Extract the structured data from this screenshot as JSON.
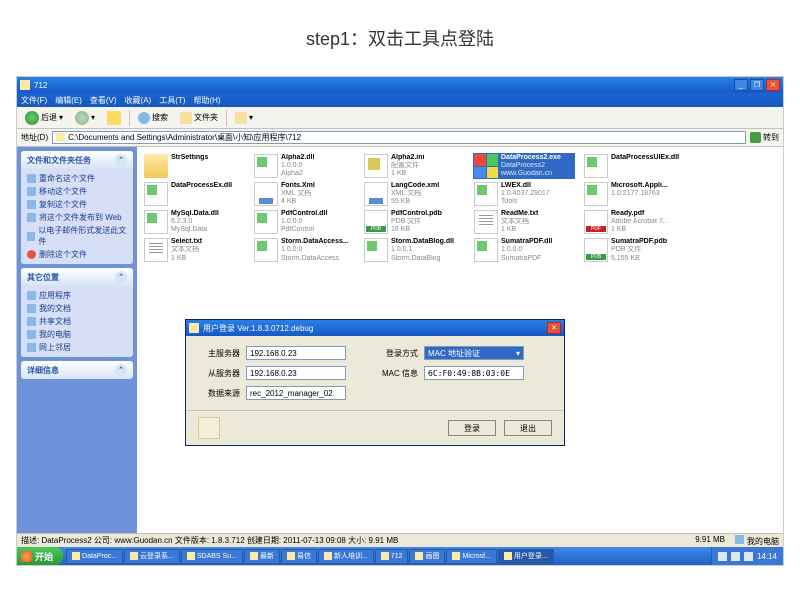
{
  "page_title": "step1：双击工具点登陆",
  "explorer": {
    "title": "712",
    "menu": [
      "文件(F)",
      "编辑(E)",
      "查看(V)",
      "收藏(A)",
      "工具(T)",
      "帮助(H)"
    ],
    "toolbar": {
      "back": "后退",
      "search": "搜索",
      "folders": "文件夹"
    },
    "address_label": "地址(D)",
    "address": "C:\\Documents and Settings\\Administrator\\桌面\\小知\\应用程序\\712",
    "go": "转到"
  },
  "sidebar": {
    "panels": [
      {
        "title": "文件和文件夹任务",
        "items": [
          {
            "icon": "rename",
            "label": "重命名这个文件"
          },
          {
            "icon": "move",
            "label": "移动这个文件"
          },
          {
            "icon": "copy",
            "label": "复制这个文件"
          },
          {
            "icon": "web",
            "label": "将这个文件发布到 Web"
          },
          {
            "icon": "mail",
            "label": "以电子邮件形式发送此文件"
          },
          {
            "icon": "del",
            "label": "删除这个文件"
          }
        ]
      },
      {
        "title": "其它位置",
        "items": [
          {
            "icon": "folder",
            "label": "应用程序"
          },
          {
            "icon": "docs",
            "label": "我的文档"
          },
          {
            "icon": "shared",
            "label": "共享文档"
          },
          {
            "icon": "pc",
            "label": "我的电脑"
          },
          {
            "icon": "net",
            "label": "网上邻居"
          }
        ]
      },
      {
        "title": "详细信息",
        "items": []
      }
    ]
  },
  "files": [
    {
      "icon": "folder",
      "name": "StrSettings",
      "meta1": "",
      "meta2": ""
    },
    {
      "icon": "dll",
      "name": "Alpha2.dll",
      "meta1": "1.0.0.0",
      "meta2": "Alpha2"
    },
    {
      "icon": "ini",
      "name": "Alpha2.ini",
      "meta1": "配置文件",
      "meta2": "1 KB"
    },
    {
      "icon": "exe",
      "name": "DataProcess2.exe",
      "meta1": "DataProcess2",
      "meta2": "www.Guodan.cn",
      "selected": true
    },
    {
      "icon": "dll",
      "name": "DataProcessUIEx.dll",
      "meta1": "",
      "meta2": ""
    },
    {
      "icon": "dll",
      "name": "DataProcessEx.dll",
      "meta1": "",
      "meta2": ""
    },
    {
      "icon": "xml",
      "name": "Fonts.Xml",
      "meta1": "XML 文档",
      "meta2": "4 KB"
    },
    {
      "icon": "xml",
      "name": "LangCode.xml",
      "meta1": "XML 文档",
      "meta2": "55 KB"
    },
    {
      "icon": "dll",
      "name": "LWEX.dll",
      "meta1": "1.0.4037.29017",
      "meta2": "Tools"
    },
    {
      "icon": "dll",
      "name": "Microsoft.Appli...",
      "meta1": "1.0.2177.18763",
      "meta2": ""
    },
    {
      "icon": "dll",
      "name": "MySql.Data.dll",
      "meta1": "6.2.3.0",
      "meta2": "MySql.Data"
    },
    {
      "icon": "dll",
      "name": "PdfControl.dll",
      "meta1": "1.0.0.0",
      "meta2": "PdfControl"
    },
    {
      "icon": "pdb",
      "name": "PdfControl.pdb",
      "meta1": "PDB 文件",
      "meta2": "16 KB"
    },
    {
      "icon": "txt",
      "name": "ReadMe.txt",
      "meta1": "文本文档",
      "meta2": "1 KB"
    },
    {
      "icon": "pdf",
      "name": "Ready.pdf",
      "meta1": "Adobe Acrobat 7...",
      "meta2": "1 KB"
    },
    {
      "icon": "txt",
      "name": "Select.txt",
      "meta1": "文本文档",
      "meta2": "1 KB"
    },
    {
      "icon": "dll",
      "name": "Storm.DataAccess...",
      "meta1": "1.0.0.0",
      "meta2": "Storm.DataAccess"
    },
    {
      "icon": "dll",
      "name": "Storm.DataBlog.dll",
      "meta1": "1.0.0.1",
      "meta2": "Storm.DataBlog"
    },
    {
      "icon": "dll",
      "name": "SumatraPDF.dll",
      "meta1": "1.0.0.0",
      "meta2": "SumatraPDF"
    },
    {
      "icon": "pdb",
      "name": "SumatraPDF.pdb",
      "meta1": "PDB 文件",
      "meta2": "5,155 KB"
    }
  ],
  "login": {
    "title": "用户登录  Ver.1.8.3.0712.debug",
    "main_server_label": "主服务器",
    "main_server": "192.168.0.23",
    "sub_server_label": "从服务器",
    "sub_server": "192.168.0.23",
    "data_source_label": "数据来源",
    "data_source": "rec_2012_manager_02",
    "login_mode_label": "登录方式",
    "login_mode": "MAC 地址验证",
    "mac_label": "MAC 信息",
    "mac": "6C:F0:49:8B:03:0E",
    "login_btn": "登录",
    "exit_btn": "退出"
  },
  "statusbar": {
    "desc": "描述: DataProcess2 公司: www.Guodan.cn 文件版本: 1.8.3.712 创建日期: 2011-07-13 09:08 大小: 9.91 MB",
    "size": "9.91 MB",
    "location": "我的电脑"
  },
  "taskbar": {
    "start": "开始",
    "items": [
      "DataProc...",
      "云登录系...",
      "SDABS Su...",
      "最新",
      "易信",
      "新人培训...",
      "712",
      "画图",
      "Microsf...",
      "用户登录..."
    ],
    "clock": "14:14"
  }
}
